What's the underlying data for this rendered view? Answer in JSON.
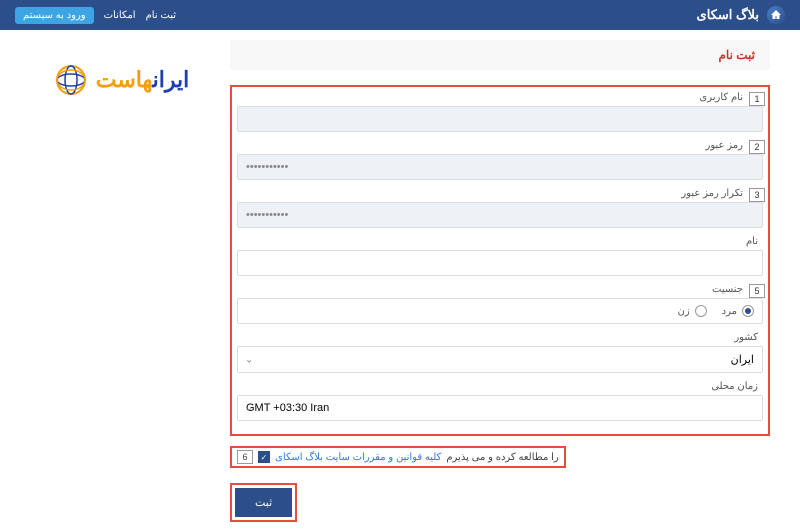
{
  "header": {
    "title": "بلاگ اسکای",
    "nav": {
      "signup": "ثبت نام",
      "features": "امکانات"
    },
    "login_btn": "ورود به سیستم"
  },
  "brand": {
    "part1": "ایران",
    "part2": "هاست"
  },
  "page": {
    "title": "ثبت نام"
  },
  "form": {
    "username": {
      "label": "نام کاربری",
      "num": "1",
      "value": ""
    },
    "password": {
      "label": "رمز عبور",
      "num": "2",
      "value": "•••••••••••"
    },
    "password2": {
      "label": "تکرار رمز عبور",
      "num": "3",
      "value": "•••••••••••"
    },
    "name": {
      "label": "نام",
      "value": ""
    },
    "gender": {
      "label": "جنسیت",
      "num": "5",
      "opt1": "مرد",
      "opt2": "زن"
    },
    "country": {
      "label": "کشور",
      "value": "ایران"
    },
    "timezone": {
      "label": "زمان محلی",
      "value": "GMT +03:30 Iran"
    }
  },
  "terms": {
    "num": "6",
    "text1": "کلیه قوانین و مقررات سایت بلاگ اسکای",
    "text2": " را مطالعه کرده و می پذیرم"
  },
  "submit": {
    "label": "ثبت"
  }
}
